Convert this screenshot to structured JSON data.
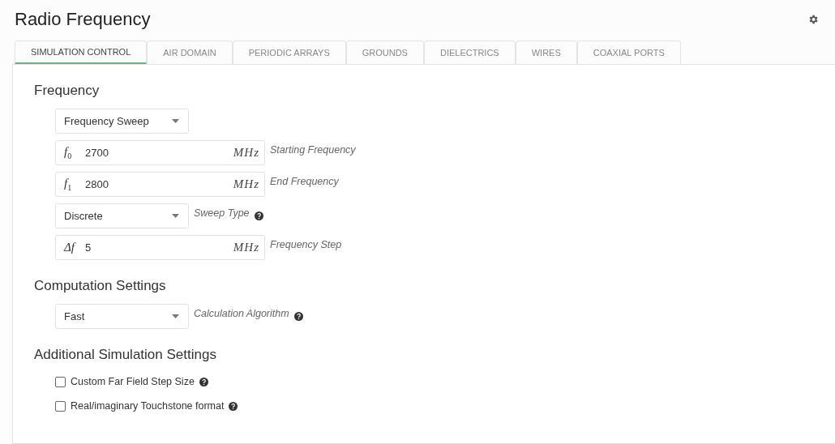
{
  "title": "Radio Frequency",
  "tabs": [
    {
      "label": "SIMULATION CONTROL",
      "selected": true
    },
    {
      "label": "AIR DOMAIN",
      "selected": false
    },
    {
      "label": "PERIODIC ARRAYS",
      "selected": false
    },
    {
      "label": "GROUNDS",
      "selected": false
    },
    {
      "label": "DIELECTRICS",
      "selected": false
    },
    {
      "label": "WIRES",
      "selected": false
    },
    {
      "label": "COAXIAL PORTS",
      "selected": false
    }
  ],
  "sections": [
    {
      "heading": "Frequency",
      "rows": [
        {
          "kind": "select",
          "value": "Frequency Sweep"
        },
        {
          "kind": "number",
          "symbol": "f",
          "subscript": "0",
          "value": "2700",
          "unit": "MHz",
          "label": "Starting Frequency"
        },
        {
          "kind": "number",
          "symbol": "f",
          "subscript": "1",
          "value": "2800",
          "unit": "MHz",
          "label": "End Frequency"
        },
        {
          "kind": "select",
          "value": "Discrete",
          "label": "Sweep Type",
          "help": true
        },
        {
          "kind": "number",
          "symbol": "Δf",
          "value": "5",
          "unit": "MHz",
          "label": "Frequency Step"
        }
      ]
    },
    {
      "heading": "Computation Settings",
      "rows": [
        {
          "kind": "select",
          "value": "Fast",
          "label": "Calculation Algorithm",
          "help": true
        }
      ]
    },
    {
      "heading": "Additional Simulation Settings",
      "rows": [
        {
          "kind": "checkbox",
          "label": "Custom Far Field Step Size",
          "checked": false,
          "help": true
        },
        {
          "kind": "checkbox",
          "label": "Real/imaginary Touchstone format",
          "checked": false,
          "help": true
        }
      ]
    }
  ]
}
